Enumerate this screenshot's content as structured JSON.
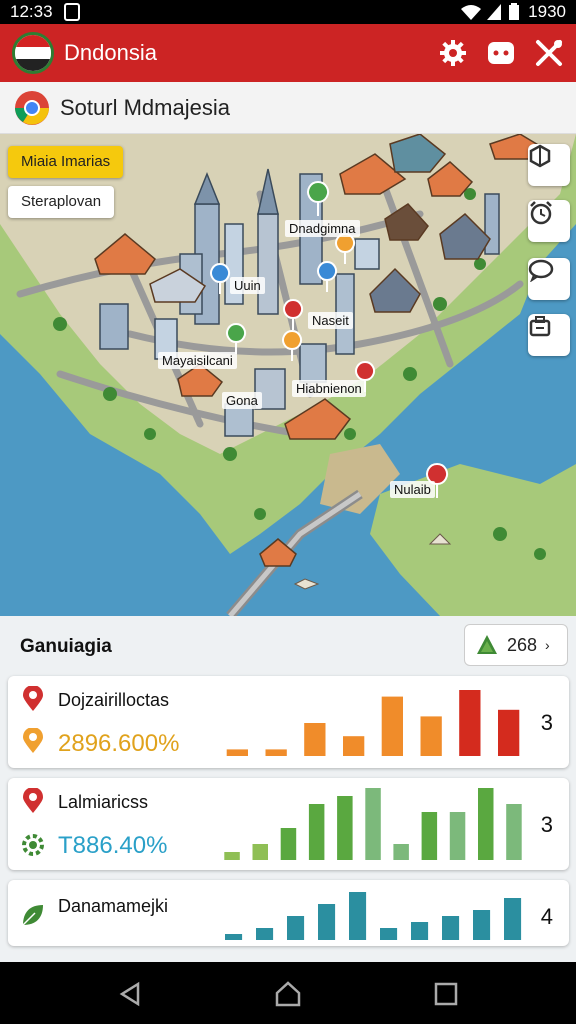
{
  "status_bar": {
    "time": "12:33",
    "battery_text": "1930"
  },
  "app_bar": {
    "title": "Dndonsia",
    "actions": [
      "gear-icon",
      "game-controller-icon",
      "tools-icon"
    ],
    "color": "#cc2424"
  },
  "search": {
    "text": "Soturl Mdmajesia"
  },
  "map": {
    "chips": {
      "primary": "Miaia Imarias",
      "secondary": "Steraplovan"
    },
    "labels": {
      "label_1": "Dnadgimna",
      "label_2": "Uuin",
      "label_3": "Naseit",
      "label_4": "Mayaisilcani",
      "label_5": "Gona",
      "label_6": "Hiabnienon",
      "label_7": "Nulaib"
    },
    "side_buttons": [
      "hexagon-icon",
      "alarm-clock-icon",
      "chat-bubble-icon",
      "briefcase-icon"
    ]
  },
  "panel": {
    "title": "Ganuiagia",
    "count": "268",
    "cards": [
      {
        "name": "Dojzairilloctas",
        "pct": "2896.600%",
        "number": "3",
        "pct_color": "#e0a21c",
        "bar_values": [
          1,
          1,
          5,
          3,
          9,
          6,
          10,
          7
        ],
        "bar_colors": [
          "#f08c2a",
          "#f08c2a",
          "#f08c2a",
          "#f08c2a",
          "#f08c2a",
          "#f08c2a",
          "#d42b1e",
          "#d42b1e"
        ]
      },
      {
        "name": "Lalmiaricss",
        "pct": "T886.40%",
        "number": "3",
        "pct_color": "#2aa0c8",
        "bar_values": [
          1,
          2,
          4,
          7,
          8,
          9,
          2,
          6,
          6,
          9,
          7
        ],
        "bar_colors": [
          "#8fbf55",
          "#8fbf55",
          "#5aa840",
          "#5aa840",
          "#5aa840",
          "#7cb97b",
          "#7cb97b",
          "#5aa840",
          "#7cb97b",
          "#5aa840",
          "#7cb97b"
        ]
      },
      {
        "name": "Danamamejki",
        "number": "4",
        "bar_values": [
          1,
          2,
          4,
          6,
          8,
          2,
          3,
          4,
          5,
          7
        ],
        "bar_colors": [
          "#2b8fa0",
          "#2b8fa0",
          "#2b8fa0",
          "#2b8fa0",
          "#2b8fa0",
          "#2b8fa0",
          "#2b8fa0",
          "#2b8fa0",
          "#2b8fa0",
          "#2b8fa0"
        ]
      }
    ]
  }
}
